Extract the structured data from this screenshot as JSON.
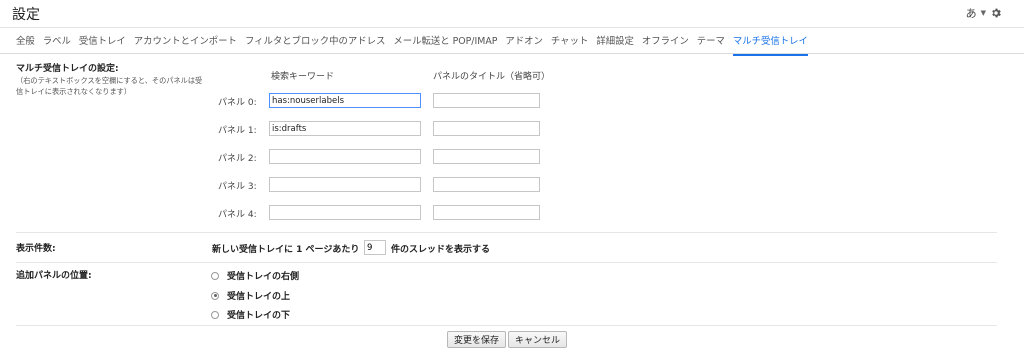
{
  "page": {
    "title": "設定",
    "language_indicator": "あ"
  },
  "tabs": [
    {
      "label": "全般"
    },
    {
      "label": "ラベル"
    },
    {
      "label": "受信トレイ"
    },
    {
      "label": "アカウントとインポート"
    },
    {
      "label": "フィルタとブロック中のアドレス"
    },
    {
      "label": "メール転送と POP/IMAP"
    },
    {
      "label": "アドオン"
    },
    {
      "label": "チャット"
    },
    {
      "label": "詳細設定"
    },
    {
      "label": "オフライン"
    },
    {
      "label": "テーマ"
    },
    {
      "label": "マルチ受信トレイ",
      "active": true
    }
  ],
  "multi_inbox": {
    "section_title": "マルチ受信トレイの設定:",
    "description": "（右のテキストボックスを空欄にすると、そのパネルは受信トレイに表示されなくなります）",
    "col_keyword": "検索キーワード",
    "col_title": "パネルのタイトル（省略可）",
    "panels": [
      {
        "label": "パネル 0:",
        "keyword": "has:nouserlabels",
        "title": ""
      },
      {
        "label": "パネル 1:",
        "keyword": "is:drafts",
        "title": ""
      },
      {
        "label": "パネル 2:",
        "keyword": "",
        "title": ""
      },
      {
        "label": "パネル 3:",
        "keyword": "",
        "title": ""
      },
      {
        "label": "パネル 4:",
        "keyword": "",
        "title": ""
      }
    ]
  },
  "display_count": {
    "label": "表示件数:",
    "prefix": "新しい受信トレイに 1 ページあたり",
    "value": "9",
    "suffix": "件のスレッドを表示する"
  },
  "panel_position": {
    "label": "追加パネルの位置:",
    "options": [
      {
        "label": "受信トレイの右側",
        "checked": false
      },
      {
        "label": "受信トレイの上",
        "checked": true
      },
      {
        "label": "受信トレイの下",
        "checked": false
      }
    ]
  },
  "buttons": {
    "save": "変更を保存",
    "cancel": "キャンセル"
  }
}
